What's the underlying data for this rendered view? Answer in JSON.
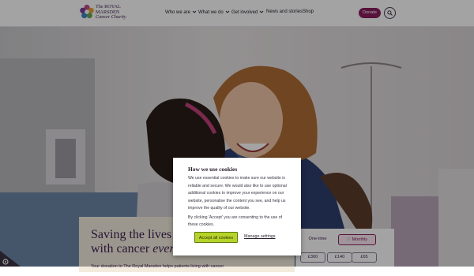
{
  "logo": {
    "line1": "The ROYAL",
    "line2": "MARSDEN",
    "line3": "Cancer Charity"
  },
  "nav": {
    "items": [
      {
        "label": "Who we are",
        "has_dropdown": true
      },
      {
        "label": "What we do",
        "has_dropdown": true
      },
      {
        "label": "Get involved",
        "has_dropdown": true
      },
      {
        "label": "News and stories",
        "has_dropdown": false
      },
      {
        "label": "Shop",
        "has_dropdown": false
      }
    ],
    "donate_label": "Donate",
    "search_icon": "search-icon"
  },
  "hero": {
    "headline_line1": "Saving the lives",
    "headline_line2_start": "with cancer ",
    "headline_line2_em": "every",
    "body": "Your donation to The Royal Marsden helps patients living with cancer"
  },
  "donation": {
    "frequency": [
      "One-time",
      "Monthly"
    ],
    "selected_frequency": "Monthly",
    "monthly_icon": "heart-icon",
    "amounts": [
      "£300",
      "£140",
      "£65"
    ]
  },
  "cookie_modal": {
    "title": "How we use cookies",
    "paragraph1": "We use essential cookies to make sure our website is reliable and secure. We would also like to use optional additional cookies to improve your experience on our website, personalise the content you see, and help us improve the quality of our website.",
    "paragraph2": "By clicking 'Accept' you are consenting to the use of these cookies.",
    "accept_label": "Accept all cookies",
    "manage_label": "Manage settings"
  },
  "colors": {
    "brand_purple": "#3d1f52",
    "donate_magenta": "#8a1d5d",
    "accept_green": "#b7d32a",
    "card_cream": "#f3ecde"
  }
}
